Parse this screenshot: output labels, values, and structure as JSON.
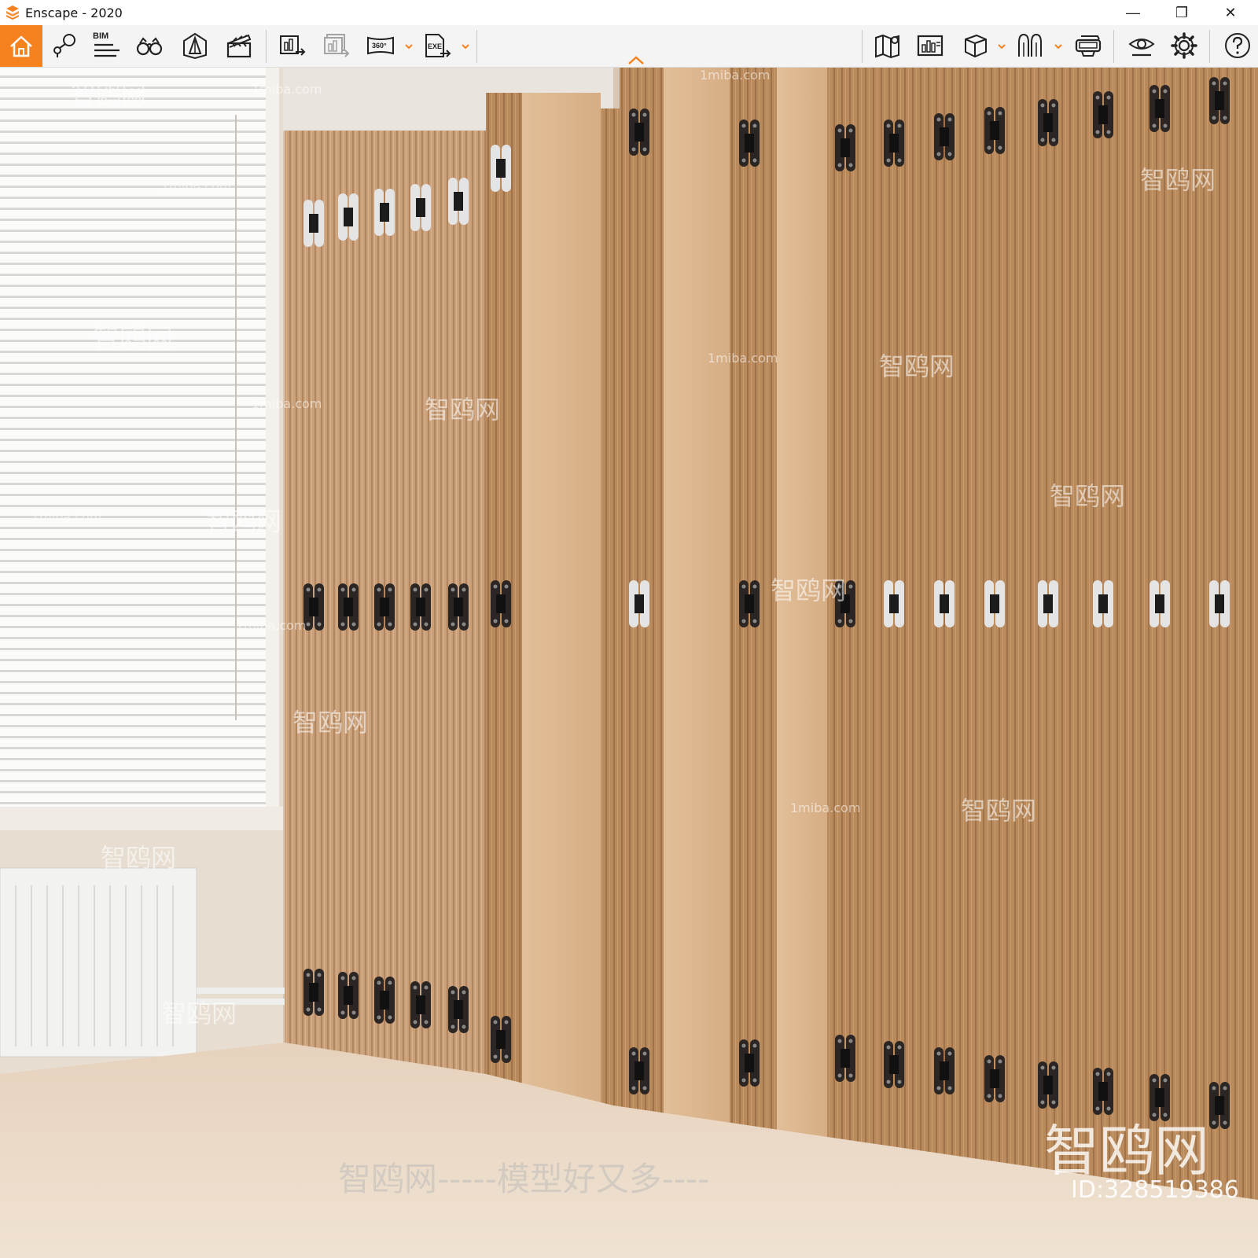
{
  "window": {
    "title": "Enscape - 2020",
    "minimize_glyph": "—",
    "restore_glyph": "❐",
    "close_glyph": "✕"
  },
  "toolbar": {
    "bim_label": "BIM",
    "video_360_label": "360°",
    "exe_label": "EXE",
    "accent_color": "#f5821f",
    "left_tools": [
      {
        "name": "home-icon"
      },
      {
        "name": "location-pin-icon"
      },
      {
        "name": "bim-info-icon"
      },
      {
        "name": "binoculars-icon"
      },
      {
        "name": "perspective-view-icon"
      },
      {
        "name": "clapperboard-icon"
      },
      {
        "name": "batch-render-icon"
      },
      {
        "name": "render-panorama-icon"
      },
      {
        "name": "export-360-icon"
      },
      {
        "name": "export-exe-icon"
      }
    ],
    "right_tools": [
      {
        "name": "map-icon"
      },
      {
        "name": "material-editor-icon"
      },
      {
        "name": "cube-view-icon"
      },
      {
        "name": "asset-library-icon"
      },
      {
        "name": "vr-headset-icon"
      },
      {
        "name": "visibility-eye-icon"
      },
      {
        "name": "settings-gear-icon"
      },
      {
        "name": "help-icon"
      }
    ]
  },
  "viewport": {
    "description_free": true,
    "watermarks": {
      "site": "1miba.com",
      "brand": "智鸥网",
      "slogan": "智鸥网-----模型好又多----",
      "image_id": "ID:328519386"
    }
  }
}
